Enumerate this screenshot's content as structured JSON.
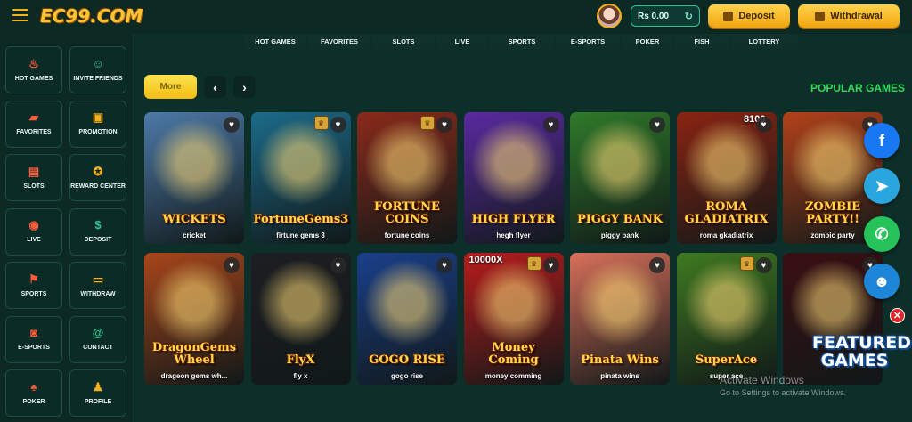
{
  "header": {
    "logo": "EC99.COM",
    "balance": "Rs 0.00",
    "deposit_label": "Deposit",
    "withdrawal_label": "Withdrawal"
  },
  "sidebar": {
    "items": [
      {
        "label": "HOT GAMES",
        "icon": "fire-icon"
      },
      {
        "label": "INVITE FRIENDS",
        "icon": "users-icon"
      },
      {
        "label": "FAVORITES",
        "icon": "folder-icon"
      },
      {
        "label": "PROMOTION",
        "icon": "gift-icon"
      },
      {
        "label": "SLOTS",
        "icon": "slot-machine-icon"
      },
      {
        "label": "REWARD CENTER",
        "icon": "medal-icon"
      },
      {
        "label": "LIVE",
        "icon": "live-icon"
      },
      {
        "label": "DEPOSIT",
        "icon": "dollar-icon"
      },
      {
        "label": "SPORTS",
        "icon": "sports-icon"
      },
      {
        "label": "WITHDRAW",
        "icon": "withdraw-icon"
      },
      {
        "label": "E-SPORTS",
        "icon": "gamepad-icon"
      },
      {
        "label": "CONTACT",
        "icon": "at-icon"
      },
      {
        "label": "POKER",
        "icon": "poker-icon"
      },
      {
        "label": "PROFILE",
        "icon": "profile-icon"
      }
    ]
  },
  "tabs": [
    "HOT GAMES",
    "FAVORITES",
    "SLOTS",
    "LIVE",
    "SPORTS",
    "E-SPORTS",
    "POKER",
    "FISH",
    "LOTTERY"
  ],
  "controls": {
    "more_label": "More",
    "prev": "‹",
    "next": "›",
    "section_title": "POPULAR GAMES"
  },
  "games": [
    {
      "name": "cricket",
      "art_title": "WICKETS",
      "bg": "#4d7aa8",
      "badge": false
    },
    {
      "name": "firtune gems 3",
      "art_title": "FortuneGems3",
      "bg": "#1c6b8a",
      "badge": true
    },
    {
      "name": "fortune coins",
      "art_title": "FORTUNE COINS",
      "bg": "#8a2a1a",
      "badge": true
    },
    {
      "name": "hegh flyer",
      "art_title": "HIGH FLYER",
      "bg": "#5a2aa0",
      "badge": false
    },
    {
      "name": "piggy bank",
      "art_title": "PIGGY BANK",
      "bg": "#2f7a2a",
      "badge": false
    },
    {
      "name": "roma gkadiatrix",
      "art_title": "ROMA GLADIATRIX",
      "bg": "#8a2412",
      "badge": false,
      "corner": "8100"
    },
    {
      "name": "zombic party",
      "art_title": "ZOMBIE PARTY!!",
      "bg": "#b3421a",
      "badge": false
    },
    {
      "name": "dra­geon gems wh...",
      "art_title": "DragonGems Wheel",
      "bg": "#a8461a",
      "badge": false
    },
    {
      "name": "fly x",
      "art_title": "FlyX",
      "bg": "#1e1e22",
      "badge": false
    },
    {
      "name": "gogo rise",
      "art_title": "GOGO RISE",
      "bg": "#1a3f8a",
      "badge": false
    },
    {
      "name": "money comming",
      "art_title": "Money Coming",
      "bg": "#b81c1c",
      "badge": true,
      "corner": "10000X"
    },
    {
      "name": "pinata wins",
      "art_title": "Pinata Wins",
      "bg": "#d8705a",
      "badge": false
    },
    {
      "name": "super ace",
      "art_title": "SuperAce",
      "bg": "#3f7a20",
      "badge": true
    },
    {
      "name": "",
      "art_title": "",
      "bg": "#3a0e12",
      "badge": false
    }
  ],
  "social": [
    {
      "name": "facebook",
      "glyph": "f",
      "color": "#1877f2"
    },
    {
      "name": "telegram",
      "glyph": "➤",
      "color": "#2aa6df"
    },
    {
      "name": "whatsapp",
      "glyph": "✆",
      "color": "#25c35a"
    },
    {
      "name": "support",
      "glyph": "☻",
      "color": "#1e86d8"
    }
  ],
  "featured": {
    "title": "FEATURED GAMES",
    "close": "✕"
  },
  "watermark": {
    "line1": "Activate Windows",
    "line2": "Go to Settings to activate Windows."
  }
}
